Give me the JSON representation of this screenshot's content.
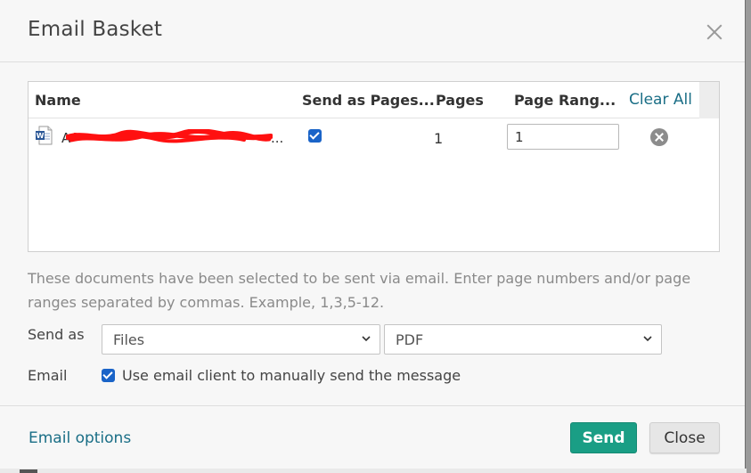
{
  "dialog": {
    "title": "Email Basket"
  },
  "table": {
    "columns": {
      "name": "Name",
      "send_as_pages": "Send as Pages...",
      "pages": "Pages",
      "page_range": "Page Rang...",
      "clear_all": "Clear All"
    },
    "rows": [
      {
        "name_visible_prefix": "A",
        "name_suffix": "...",
        "send_as_pages_checked": true,
        "pages": "1",
        "page_range": "1",
        "icon": "word-document-icon"
      }
    ]
  },
  "help_text": "These documents have been selected to be sent via email. Enter page numbers and/or page ranges separated by commas. Example, 1,3,5-12.",
  "form": {
    "send_as_label": "Send as",
    "send_as_value": "Files",
    "format_value": "PDF",
    "email_label": "Email",
    "email_client_checked": true,
    "email_client_text": "Use email client to manually send the message"
  },
  "footer": {
    "email_options": "Email options",
    "send": "Send",
    "close": "Close"
  },
  "colors": {
    "accent": "#1a9e85",
    "link": "#1a6e86",
    "checkbox": "#1a64c8",
    "redaction": "#ff1010"
  }
}
